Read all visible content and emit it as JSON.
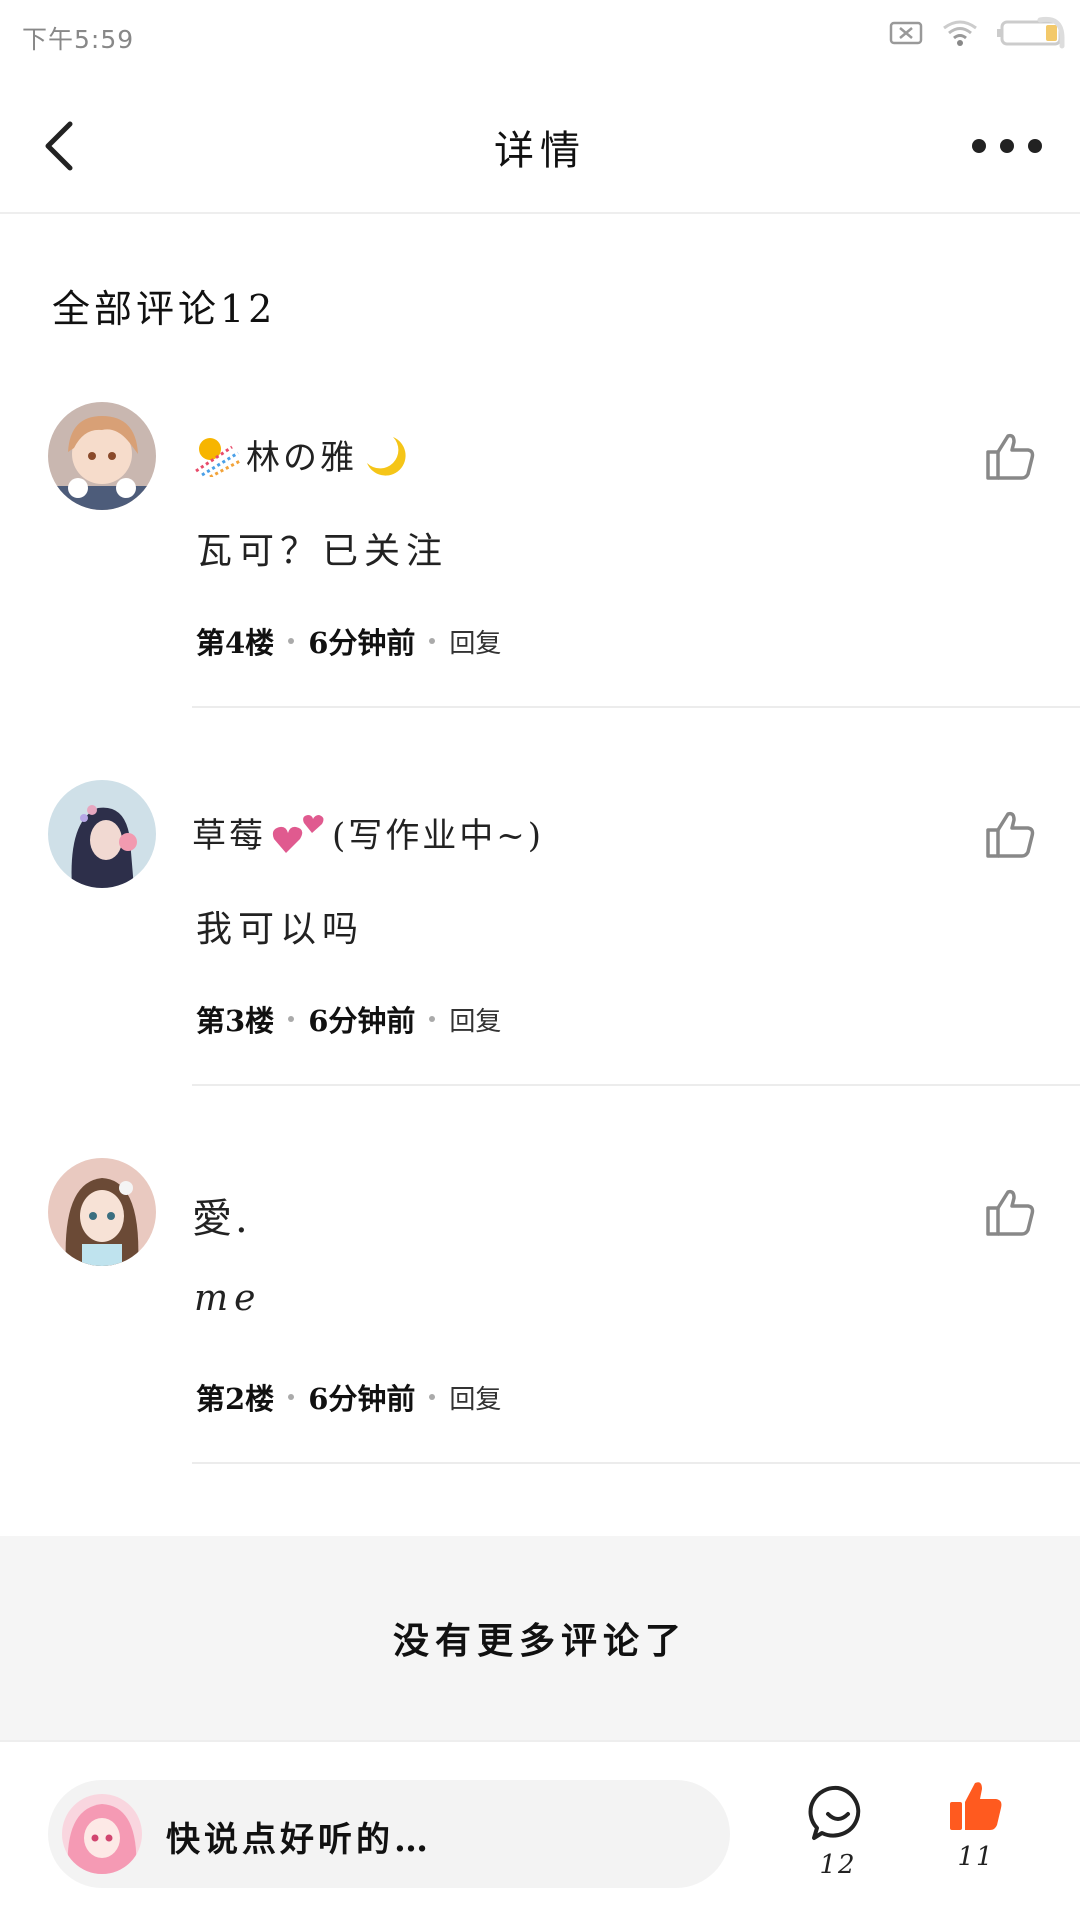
{
  "status_bar": {
    "time": "下午5:59"
  },
  "nav": {
    "title": "详情"
  },
  "section": {
    "title": "全部评论12"
  },
  "comments": [
    {
      "name": "林の雅",
      "text": "瓦可？已关注",
      "floor": "第4楼",
      "time": "6分钟前",
      "reply": "回复"
    },
    {
      "name": "草莓",
      "name_suffix": "(写作业中~)",
      "text": "我可以吗",
      "floor": "第3楼",
      "time": "6分钟前",
      "reply": "回复"
    },
    {
      "name": "愛.",
      "text": "me",
      "floor": "第2楼",
      "time": "6分钟前",
      "reply": "回复"
    }
  ],
  "footer": {
    "no_more": "没有更多评论了"
  },
  "bottom": {
    "placeholder": "快说点好听的…",
    "comment_count": "12",
    "like_count": "11"
  },
  "colors": {
    "accent": "#ff5a1f",
    "divider": "#ececec",
    "footer_bg": "#f5f5f5"
  },
  "icons": [
    "back-arrow-icon",
    "more-dots-icon",
    "thumb-up-icon",
    "comment-bubble-icon",
    "thumb-up-filled-icon",
    "wifi-icon",
    "battery-icon",
    "no-sim-icon"
  ]
}
